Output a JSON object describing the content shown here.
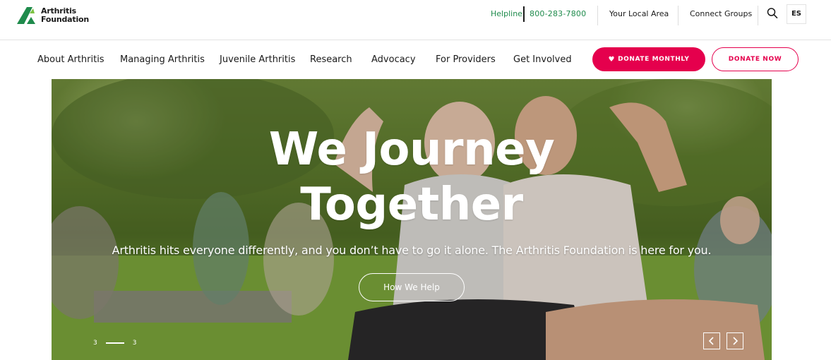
{
  "brand": {
    "name_line1": "Arthritis",
    "name_line2": "Foundation",
    "color_green": "#1f8b4c",
    "color_pink": "#e5004d"
  },
  "utility": {
    "helpline_label": "Helpline",
    "phone": "800-283-7800",
    "local_area": "Your Local Area",
    "connect_groups": "Connect Groups",
    "search_icon": "search-icon",
    "language": "ES"
  },
  "nav": {
    "items": [
      "About Arthritis",
      "Managing Arthritis",
      "Juvenile Arthritis",
      "Research",
      "Advocacy",
      "For Providers",
      "Get Involved"
    ],
    "donate_monthly": "DONATE MONTHLY",
    "donate_now": "DONATE NOW"
  },
  "hero": {
    "title_line1": "We Journey",
    "title_line2": "Together",
    "subtitle": "Arthritis hits everyone differently, and you don’t have to go it alone. The Arthritis Foundation is here for you.",
    "cta": "How We Help",
    "slide_current": "3",
    "slide_total": "3"
  }
}
